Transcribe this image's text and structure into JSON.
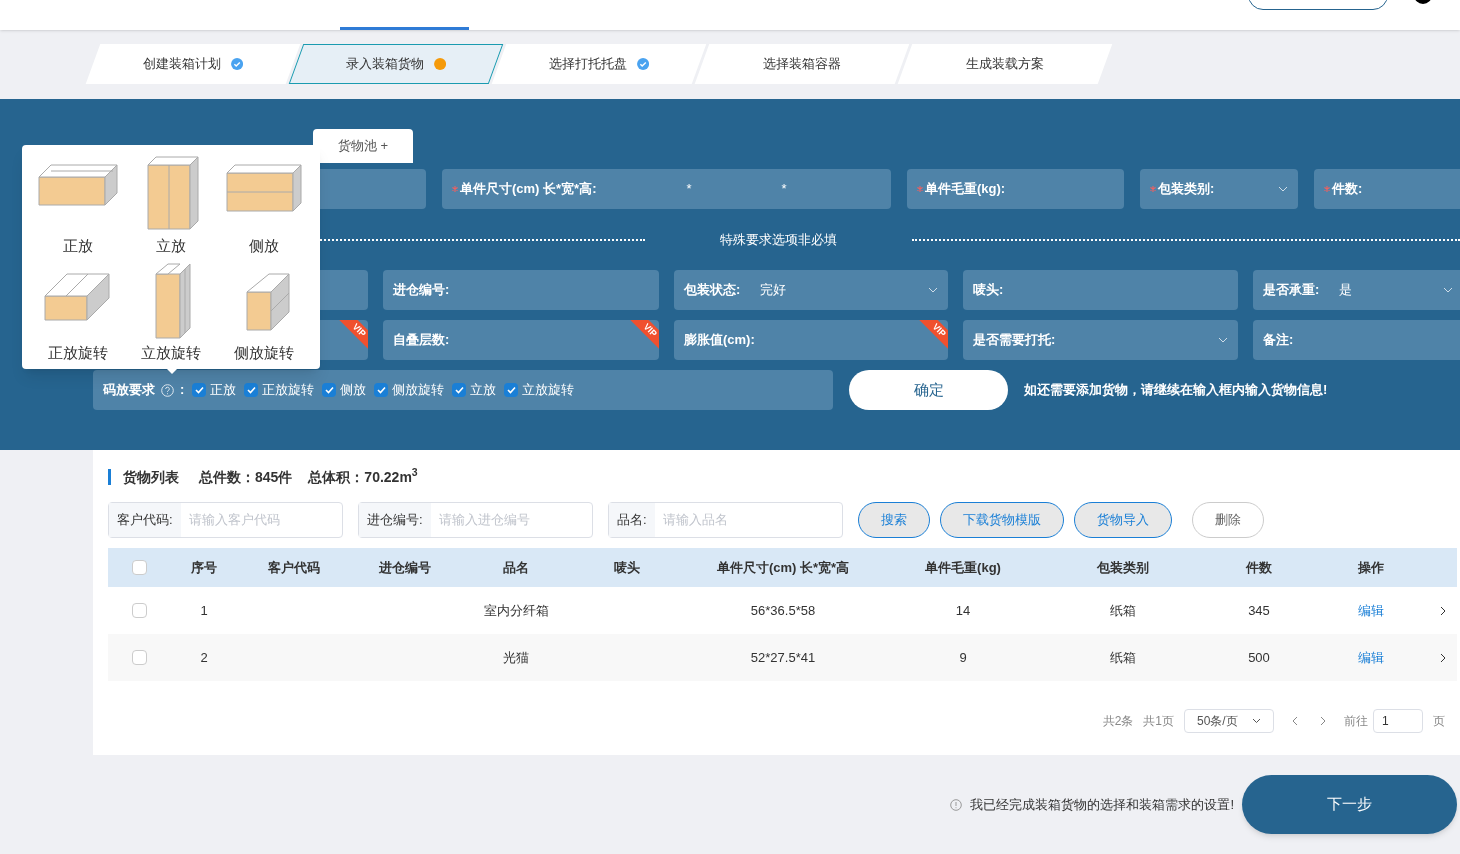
{
  "steps": [
    {
      "label": "创建装箱计划",
      "selected": false,
      "done": true
    },
    {
      "label": "录入装箱货物",
      "selected": true,
      "done": false
    },
    {
      "label": "选择打托托盘",
      "selected": false,
      "done": true
    },
    {
      "label": "选择装箱容器",
      "selected": false,
      "done": false
    },
    {
      "label": "生成装载方案",
      "selected": false,
      "done": false
    }
  ],
  "entry": {
    "pool_button": "货物池 +",
    "row_1": [
      {
        "kind": "input",
        "required": false
      },
      {
        "kind": "dims",
        "label": "单件尺寸(cm) 长*宽*高:",
        "required": true,
        "separators": [
          "*",
          "*"
        ]
      },
      {
        "kind": "input",
        "label": "单件毛重(kg):",
        "required": true
      },
      {
        "kind": "select",
        "label": "包装类别:",
        "required": true
      },
      {
        "kind": "input",
        "label": "件数:",
        "required": true
      }
    ],
    "divider_text": "特殊要求选项非必填",
    "row_2": [
      {
        "kind": "input",
        "required": false
      },
      {
        "kind": "input",
        "label": "进仓编号:",
        "required": false
      },
      {
        "kind": "select",
        "label": "包装状态:",
        "value": "完好",
        "required": false
      },
      {
        "kind": "input",
        "label": "唛头:",
        "required": false
      },
      {
        "kind": "select",
        "label": "是否承重:",
        "value": "是",
        "required": false
      }
    ],
    "row_3": [
      {
        "kind": "input",
        "required": false,
        "badge": "VIP"
      },
      {
        "kind": "input",
        "label": "自叠层数:",
        "required": false,
        "badge": "VIP"
      },
      {
        "kind": "input",
        "label": "膨胀值(cm):",
        "required": false,
        "badge": "VIP"
      },
      {
        "kind": "select",
        "label": "是否需要打托:",
        "required": false
      },
      {
        "kind": "input",
        "label": "备注:",
        "required": false
      }
    ],
    "stacking": {
      "label": "码放要求",
      "separator": ":",
      "options": [
        {
          "label": "正放",
          "checked": true
        },
        {
          "label": "正放旋转",
          "checked": true
        },
        {
          "label": "侧放",
          "checked": true
        },
        {
          "label": "侧放旋转",
          "checked": true
        },
        {
          "label": "立放",
          "checked": true
        },
        {
          "label": "立放旋转",
          "checked": true
        }
      ]
    },
    "confirm_button": "确定",
    "hint": "如还需要添加货物，请继续在输入框内输入货物信息!",
    "popover": [
      {
        "label": "正放",
        "kind": "flat"
      },
      {
        "label": "立放",
        "kind": "upright"
      },
      {
        "label": "侧放",
        "kind": "side"
      },
      {
        "label": "正放旋转",
        "kind": "flat_rotated"
      },
      {
        "label": "立放旋转",
        "kind": "upright_rotated"
      },
      {
        "label": "侧放旋转",
        "kind": "side_rotated"
      }
    ]
  },
  "list": {
    "title": "货物列表",
    "total_count": "总件数：845件",
    "total_volume": "总体积：70.22m$^{3}$",
    "filters": [
      {
        "label": "客户代码:",
        "placeholder": "请输入客户代码"
      },
      {
        "label": "进仓编号:",
        "placeholder": "请输入进仓编号"
      },
      {
        "label": "品名:",
        "placeholder": "请输入品名"
      }
    ],
    "buttons": [
      {
        "label": "搜索",
        "kind": "primary"
      },
      {
        "label": "下载货物模版",
        "kind": "primary"
      },
      {
        "label": "货物导入",
        "kind": "primary"
      },
      {
        "label": "删除",
        "kind": "plain"
      }
    ],
    "columns": [
      "序号",
      "客户代码",
      "进仓编号",
      "品名",
      "唛头",
      "单件尺寸(cm) 长*宽*高",
      "单件毛重(kg)",
      "包装类别",
      "件数",
      "操作"
    ],
    "header_checked": false,
    "rows": [
      {
        "checked": false,
        "cells": [
          "1",
          "",
          "",
          "室内分纤箱",
          "",
          "56*36.5*58",
          "14",
          "纸箱",
          "345"
        ],
        "action": "编辑"
      },
      {
        "checked": false,
        "cells": [
          "2",
          "",
          "",
          "光猫",
          "",
          "52*27.5*41",
          "9",
          "纸箱",
          "500"
        ],
        "action": "编辑"
      }
    ],
    "pagination": {
      "total": "共2条",
      "pages": "共1页",
      "page_size": "50条/页",
      "goto": "前往",
      "page": "1",
      "page_unit": "页"
    }
  },
  "footer": {
    "note": "我已经完成装箱货物的选择和装箱需求的设置!",
    "next_button": "下一步"
  }
}
